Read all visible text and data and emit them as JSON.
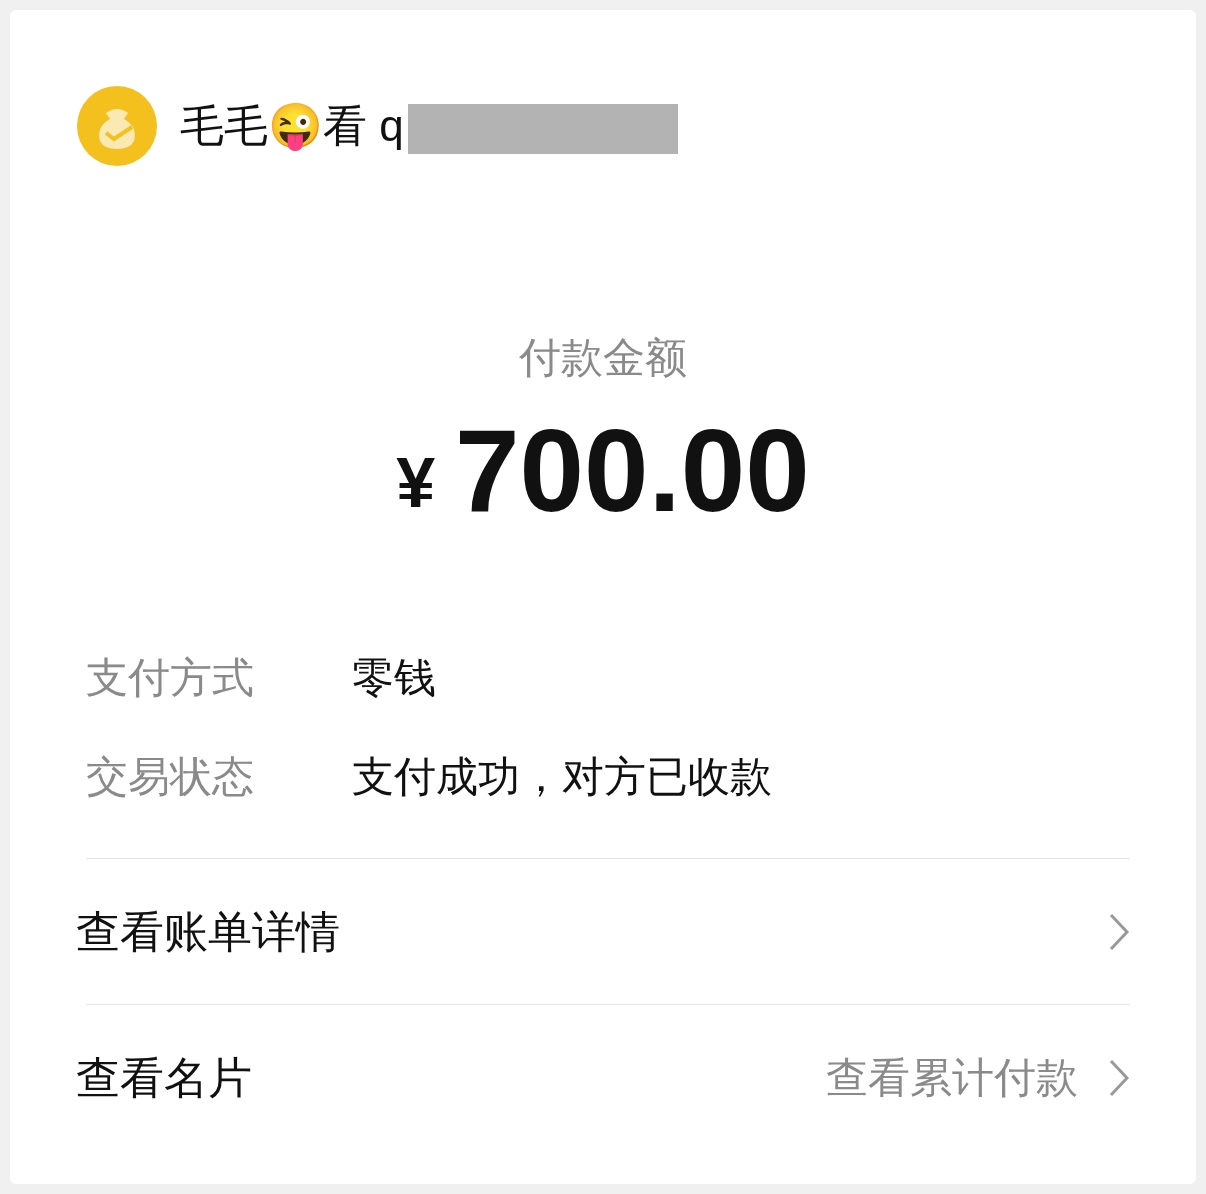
{
  "merchant": {
    "name": "毛毛😜看 q"
  },
  "amount": {
    "label": "付款金额",
    "currency": "¥",
    "value": "700.00"
  },
  "details": [
    {
      "label": "支付方式",
      "value": "零钱"
    },
    {
      "label": "交易状态",
      "value": "支付成功，对方已收款"
    }
  ],
  "links": [
    {
      "label": "查看账单详情"
    },
    {
      "label": "查看名片",
      "extra": "查看累计付款"
    }
  ]
}
